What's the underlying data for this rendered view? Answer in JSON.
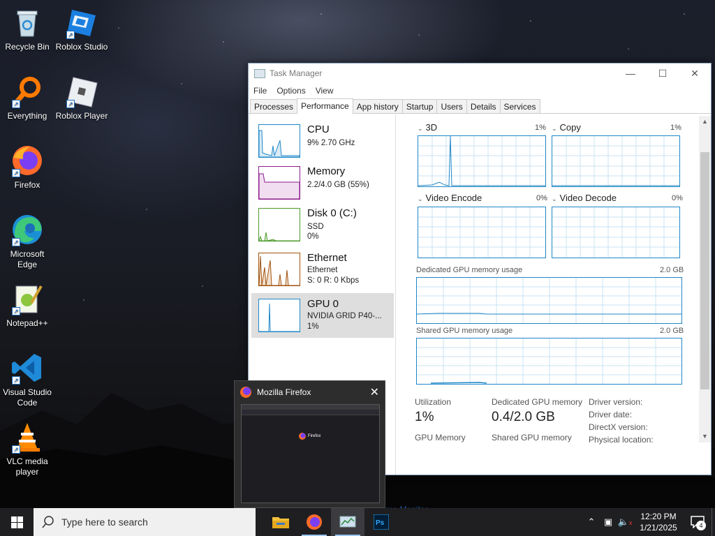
{
  "desktop": {
    "icons": [
      {
        "label": "Recycle Bin"
      },
      {
        "label": "Roblox Studio"
      },
      {
        "label": "Everything"
      },
      {
        "label": "Roblox Player"
      },
      {
        "label": "Firefox"
      },
      {
        "label": "Microsoft Edge"
      },
      {
        "label": "Notepad++"
      },
      {
        "label": "Visual Studio Code"
      },
      {
        "label": "VLC media player"
      }
    ]
  },
  "task_manager": {
    "title": "Task Manager",
    "menu": [
      "File",
      "Options",
      "View"
    ],
    "tabs": [
      "Processes",
      "Performance",
      "App history",
      "Startup",
      "Users",
      "Details",
      "Services"
    ],
    "active_tab": "Performance",
    "resources": [
      {
        "name": "CPU",
        "line1": "9% 2.70 GHz",
        "color": "#1f87c7"
      },
      {
        "name": "Memory",
        "line1": "2.2/4.0 GB (55%)",
        "color": "#8b1a8b"
      },
      {
        "name": "Disk 0 (C:)",
        "line1": "SSD",
        "line2": "0%",
        "color": "#4c9a2a"
      },
      {
        "name": "Ethernet",
        "line1": "Ethernet",
        "line2": "S: 0 R: 0 Kbps",
        "color": "#a0520d"
      },
      {
        "name": "GPU 0",
        "line1": "NVIDIA GRID P40-...",
        "line2": "1%",
        "color": "#1f87c7"
      }
    ],
    "gpu": {
      "engines": [
        {
          "name": "3D",
          "pct": "1%"
        },
        {
          "name": "Copy",
          "pct": "1%"
        },
        {
          "name": "Video Encode",
          "pct": "0%"
        },
        {
          "name": "Video Decode",
          "pct": "0%"
        }
      ],
      "dedicated_label": "Dedicated GPU memory usage",
      "dedicated_max": "2.0 GB",
      "shared_label": "Shared GPU memory usage",
      "shared_max": "2.0 GB",
      "utilization_label": "Utilization",
      "utilization_value": "1%",
      "dedicated_mem_label": "Dedicated GPU memory",
      "dedicated_mem_value": "0.4/2.0 GB",
      "gpu_memory_label": "GPU Memory",
      "shared_mem_label": "Shared GPU memory",
      "driver_version_label": "Driver version:",
      "driver_date_label": "Driver date:",
      "directx_label": "DirectX version:",
      "physical_location_label": "Physical location:"
    },
    "resource_monitor_link": "urce Monitor"
  },
  "firefox_preview": {
    "title": "Mozilla Firefox",
    "page_text": "Firefox"
  },
  "taskbar": {
    "search_placeholder": "Type here to search",
    "time": "12:20 PM",
    "date": "1/21/2025",
    "notification_count": "4"
  },
  "colors": {
    "gpu_blue": "#1f87c7",
    "taskbar": "#1f1f22",
    "search_bg": "#f0f0f0"
  }
}
